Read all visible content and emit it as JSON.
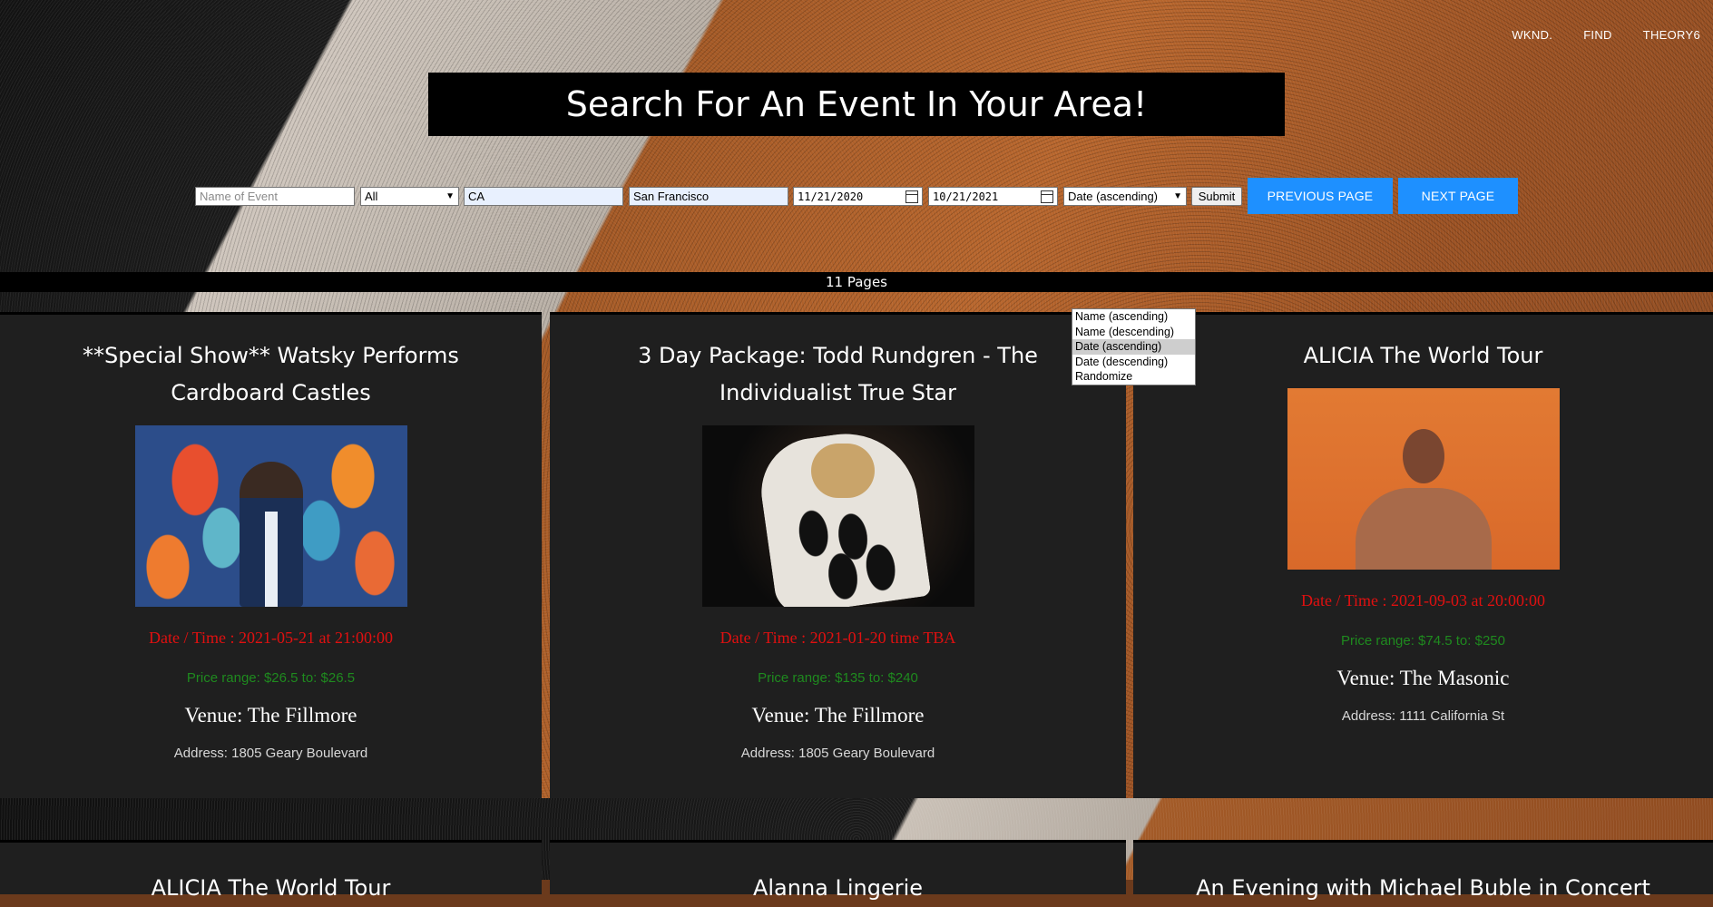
{
  "nav": {
    "items": [
      "WKND.",
      "FIND",
      "THEORY6"
    ]
  },
  "title": "Search For An Event In Your Area!",
  "search": {
    "event_name": {
      "value": "",
      "placeholder": "Name of Event"
    },
    "category": {
      "selected": "All"
    },
    "state": {
      "value": "CA"
    },
    "city": {
      "value": "San Francisco"
    },
    "start_date": "11/21/2020",
    "end_date": "10/21/2021",
    "sort": {
      "selected": "Date (ascending)"
    },
    "submit_label": "Submit",
    "prev_label": "PREVIOUS PAGE",
    "next_label": "NEXT PAGE"
  },
  "pages_text": "11 Pages",
  "sort_options": [
    "Name (ascending)",
    "Name (descending)",
    "Date (ascending)",
    "Date (descending)",
    "Randomize"
  ],
  "events": [
    {
      "name": "**Special Show** Watsky Performs Cardboard Castles",
      "datetime": "Date / Time : 2021-05-21 at 21:00:00",
      "price": "Price range: $26.5 to: $26.5",
      "venue": "Venue: The Fillmore",
      "address": "Address: 1805 Geary Boulevard"
    },
    {
      "name": "3 Day Package: Todd Rundgren - The Individualist True Star",
      "datetime": "Date / Time : 2021-01-20 time TBA",
      "price": "Price range: $135 to: $240",
      "venue": "Venue: The Fillmore",
      "address": "Address: 1805 Geary Boulevard"
    },
    {
      "name": "ALICIA The World Tour",
      "datetime": "Date / Time : 2021-09-03 at 20:00:00",
      "price": "Price range: $74.5 to: $250",
      "venue": "Venue: The Masonic",
      "address": "Address: 1111 California St"
    }
  ],
  "next_row": [
    "ALICIA The World Tour",
    "Alanna Lingerie",
    "An Evening with Michael Buble in Concert"
  ],
  "colors": {
    "accent": "#1e90ff",
    "date": "#e01010",
    "price": "#1f8a1f",
    "card": "#1f1f1f"
  }
}
